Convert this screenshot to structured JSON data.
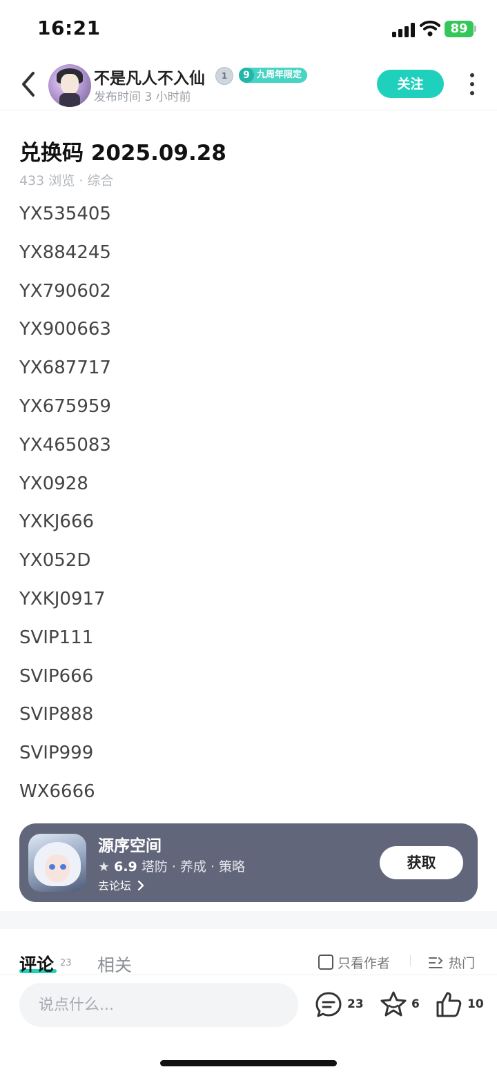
{
  "status_bar": {
    "time": "16:21",
    "battery": "89"
  },
  "header": {
    "username": "不是凡人不入仙",
    "level_badge": "1",
    "anniversary_num": "9",
    "anniversary_label": "九周年限定",
    "post_time": "发布时间 3 小时前",
    "follow_label": "关注"
  },
  "article": {
    "title": "兑换码 2025.09.28",
    "meta": "433 浏览 · 综合",
    "codes": [
      "YX535405",
      "YX884245",
      "YX790602",
      "YX900663",
      "YX687717",
      "YX675959",
      "YX465083",
      "YX0928",
      "YXKJ666",
      "YX052D",
      "YXKJ0917",
      "SVIP111",
      "SVIP666",
      "SVIP888",
      "SVIP999",
      "WX6666"
    ]
  },
  "app_card": {
    "name": "源序空间",
    "rating": "6.9",
    "tags": "塔防 · 养成 · 策略",
    "forum_link": "去论坛",
    "get_label": "获取"
  },
  "comments_tabs": {
    "comments_label": "评论",
    "comments_count": "23",
    "related_label": "相关",
    "only_author_label": "只看作者",
    "sort_label": "热门"
  },
  "bottom_bar": {
    "input_placeholder": "说点什么...",
    "comment_count": "23",
    "favorite_count": "6",
    "like_count": "10"
  },
  "colors": {
    "accent": "#1fd0bd",
    "card_bg": "#61667a",
    "battery": "#34c759"
  }
}
